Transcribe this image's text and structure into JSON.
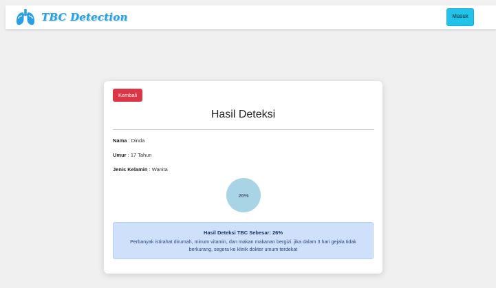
{
  "navbar": {
    "brand_title": "TBC Detection",
    "brand_icon": "lungs-logo-icon",
    "login_label": "Masuk"
  },
  "card": {
    "back_label": "Kembali",
    "title": "Hasil Deteksi",
    "fields": {
      "name_label": "Nama",
      "name_value": " : Dinda",
      "age_label": "Umur",
      "age_value": " : 17 Tahun",
      "gender_label": "Jenis Kelamin",
      "gender_value": " : Wanita"
    },
    "result_percent_text": "26%",
    "result_percent": 26,
    "alert": {
      "title": "Hasil Deteksi TBC Sebesar: 26%",
      "message": "Perbanyak istirahat dirumah, minum vitamin, dan makan makanan bergizi. jika dalam 3 hari gejala tidak berkurang, segera ke klinik dokter umum terdekat"
    }
  },
  "colors": {
    "brand": "#2aa0e4",
    "login_button": "#22c3ea",
    "back_button": "#dc3545",
    "pie_fill": "#a9d4e6",
    "alert_bg": "#cfe0fb"
  }
}
